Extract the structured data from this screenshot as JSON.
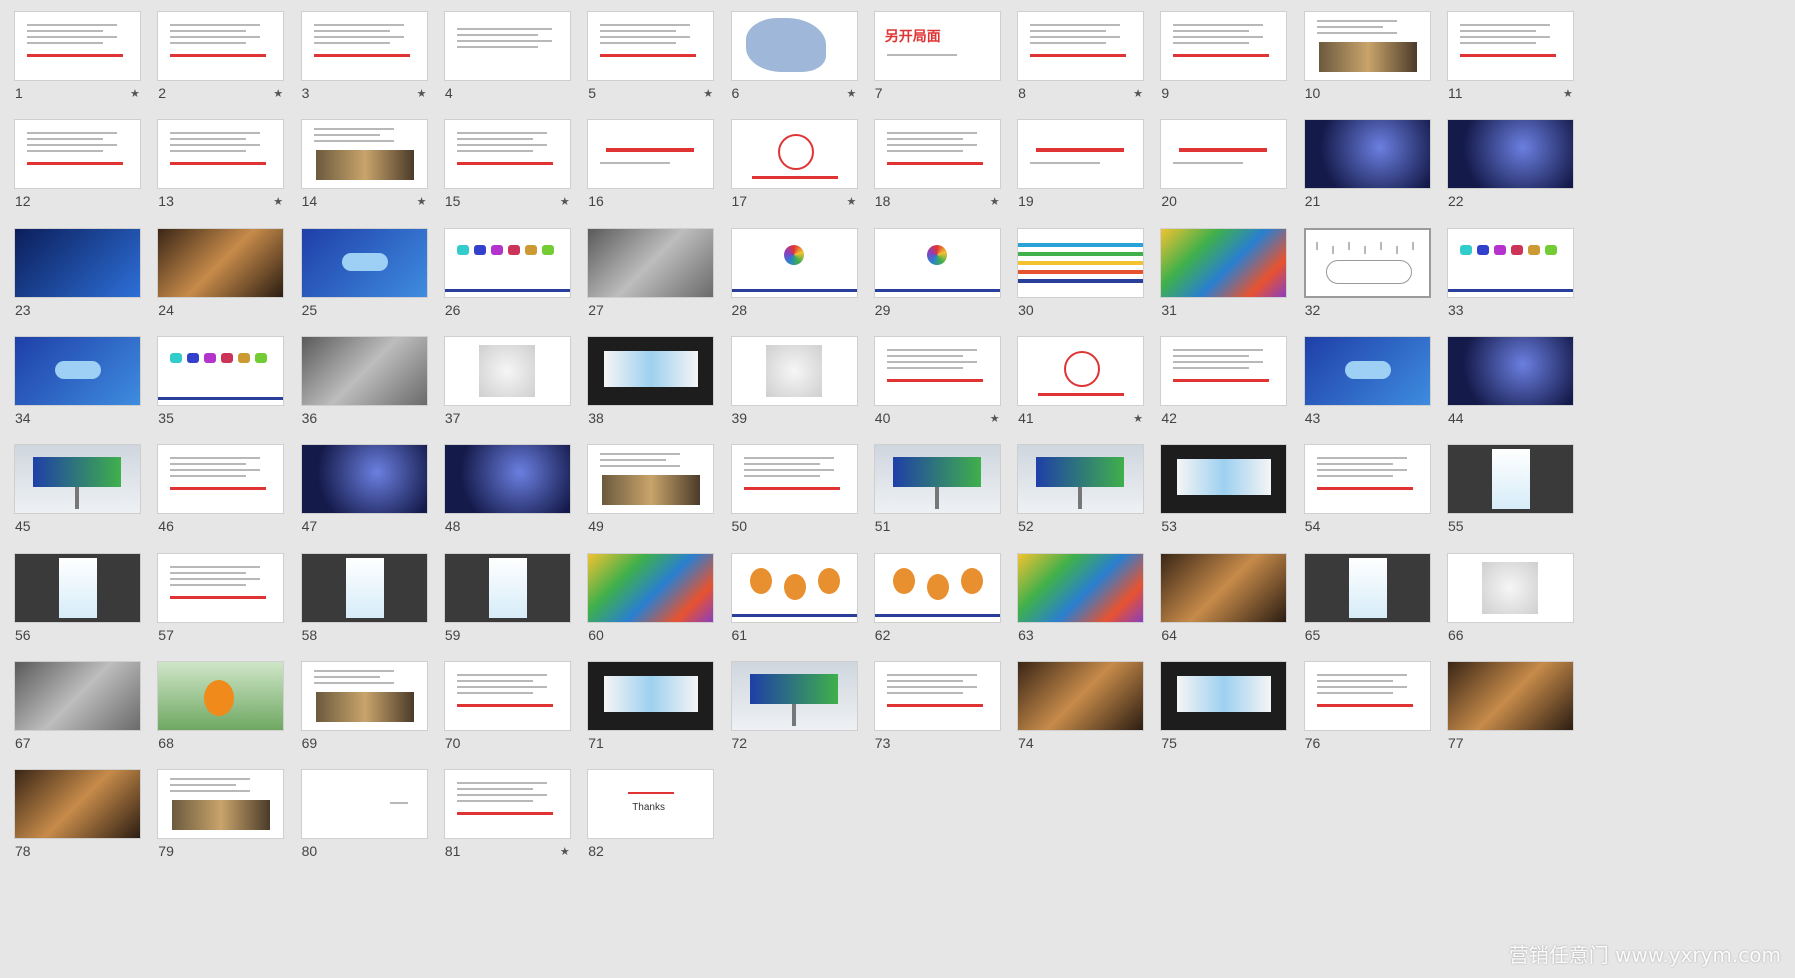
{
  "slides": [
    {
      "num": "1",
      "starred": true,
      "kind": "text-red"
    },
    {
      "num": "2",
      "starred": true,
      "kind": "text-red"
    },
    {
      "num": "3",
      "starred": true,
      "kind": "text-red"
    },
    {
      "num": "4",
      "starred": false,
      "kind": "text"
    },
    {
      "num": "5",
      "starred": true,
      "kind": "text-red"
    },
    {
      "num": "6",
      "starred": true,
      "kind": "map"
    },
    {
      "num": "7",
      "starred": false,
      "kind": "title"
    },
    {
      "num": "8",
      "starred": true,
      "kind": "text-red"
    },
    {
      "num": "9",
      "starred": false,
      "kind": "text-red"
    },
    {
      "num": "10",
      "starred": false,
      "kind": "photo-text"
    },
    {
      "num": "11",
      "starred": true,
      "kind": "text-red"
    },
    {
      "num": "12",
      "starred": false,
      "kind": "text-red"
    },
    {
      "num": "13",
      "starred": true,
      "kind": "text-red"
    },
    {
      "num": "14",
      "starred": true,
      "kind": "photo-text"
    },
    {
      "num": "15",
      "starred": true,
      "kind": "text-red"
    },
    {
      "num": "16",
      "starred": false,
      "kind": "title"
    },
    {
      "num": "17",
      "starred": true,
      "kind": "diagram"
    },
    {
      "num": "18",
      "starred": true,
      "kind": "text-red"
    },
    {
      "num": "19",
      "starred": false,
      "kind": "title"
    },
    {
      "num": "20",
      "starred": false,
      "kind": "title"
    },
    {
      "num": "21",
      "starred": false,
      "kind": "night"
    },
    {
      "num": "22",
      "starred": false,
      "kind": "night"
    },
    {
      "num": "23",
      "starred": false,
      "kind": "dark-blue"
    },
    {
      "num": "24",
      "starred": false,
      "kind": "warm"
    },
    {
      "num": "25",
      "starred": false,
      "kind": "blue"
    },
    {
      "num": "26",
      "starred": false,
      "kind": "icons"
    },
    {
      "num": "27",
      "starred": false,
      "kind": "gray-photo"
    },
    {
      "num": "28",
      "starred": false,
      "kind": "logo"
    },
    {
      "num": "29",
      "starred": false,
      "kind": "logo"
    },
    {
      "num": "30",
      "starred": false,
      "kind": "stripes"
    },
    {
      "num": "31",
      "starred": false,
      "kind": "colorful"
    },
    {
      "num": "32",
      "starred": false,
      "kind": "sketch",
      "selected": true
    },
    {
      "num": "33",
      "starred": false,
      "kind": "icons"
    },
    {
      "num": "34",
      "starred": false,
      "kind": "blue"
    },
    {
      "num": "35",
      "starred": false,
      "kind": "icons"
    },
    {
      "num": "36",
      "starred": false,
      "kind": "gray-photo"
    },
    {
      "num": "37",
      "starred": false,
      "kind": "photo-white"
    },
    {
      "num": "38",
      "starred": false,
      "kind": "dark-wall"
    },
    {
      "num": "39",
      "starred": false,
      "kind": "photo-white"
    },
    {
      "num": "40",
      "starred": true,
      "kind": "text-red"
    },
    {
      "num": "41",
      "starred": true,
      "kind": "diagram"
    },
    {
      "num": "42",
      "starred": false,
      "kind": "text-red"
    },
    {
      "num": "43",
      "starred": false,
      "kind": "blue"
    },
    {
      "num": "44",
      "starred": false,
      "kind": "night"
    },
    {
      "num": "45",
      "starred": false,
      "kind": "billboard"
    },
    {
      "num": "46",
      "starred": false,
      "kind": "text-red"
    },
    {
      "num": "47",
      "starred": false,
      "kind": "night"
    },
    {
      "num": "48",
      "starred": false,
      "kind": "night"
    },
    {
      "num": "49",
      "starred": false,
      "kind": "photo-text"
    },
    {
      "num": "50",
      "starred": false,
      "kind": "text-red"
    },
    {
      "num": "51",
      "starred": false,
      "kind": "billboard"
    },
    {
      "num": "52",
      "starred": false,
      "kind": "billboard"
    },
    {
      "num": "53",
      "starred": false,
      "kind": "dark-wall"
    },
    {
      "num": "54",
      "starred": false,
      "kind": "text-red"
    },
    {
      "num": "55",
      "starred": false,
      "kind": "poster"
    },
    {
      "num": "56",
      "starred": false,
      "kind": "poster"
    },
    {
      "num": "57",
      "starred": false,
      "kind": "text-red"
    },
    {
      "num": "58",
      "starred": false,
      "kind": "poster"
    },
    {
      "num": "59",
      "starred": false,
      "kind": "poster"
    },
    {
      "num": "60",
      "starred": false,
      "kind": "colorful"
    },
    {
      "num": "61",
      "starred": false,
      "kind": "mascot"
    },
    {
      "num": "62",
      "starred": false,
      "kind": "mascot"
    },
    {
      "num": "63",
      "starred": false,
      "kind": "colorful"
    },
    {
      "num": "64",
      "starred": false,
      "kind": "warm"
    },
    {
      "num": "65",
      "starred": false,
      "kind": "poster"
    },
    {
      "num": "66",
      "starred": false,
      "kind": "photo-white"
    },
    {
      "num": "67",
      "starred": false,
      "kind": "gray-photo"
    },
    {
      "num": "68",
      "starred": false,
      "kind": "green-photo"
    },
    {
      "num": "69",
      "starred": false,
      "kind": "photo-text"
    },
    {
      "num": "70",
      "starred": false,
      "kind": "text-red"
    },
    {
      "num": "71",
      "starred": false,
      "kind": "dark-wall"
    },
    {
      "num": "72",
      "starred": false,
      "kind": "billboard"
    },
    {
      "num": "73",
      "starred": false,
      "kind": "text-red"
    },
    {
      "num": "74",
      "starred": false,
      "kind": "warm"
    },
    {
      "num": "75",
      "starred": false,
      "kind": "dark-wall"
    },
    {
      "num": "76",
      "starred": false,
      "kind": "text-red"
    },
    {
      "num": "77",
      "starred": false,
      "kind": "warm"
    },
    {
      "num": "78",
      "starred": false,
      "kind": "warm"
    },
    {
      "num": "79",
      "starred": false,
      "kind": "photo-text"
    },
    {
      "num": "80",
      "starred": false,
      "kind": "blank"
    },
    {
      "num": "81",
      "starred": true,
      "kind": "text-red"
    },
    {
      "num": "82",
      "starred": false,
      "kind": "thanks",
      "thanks_text": "Thanks"
    }
  ],
  "star_glyph": "★",
  "title_text": {
    "7": "另开局面"
  },
  "colors": {
    "accent_red": "#e03434",
    "brand_blue": "#2a3f9a",
    "background": "#e6e6e6"
  },
  "watermark": "营销任意门 www.yxrym.com"
}
